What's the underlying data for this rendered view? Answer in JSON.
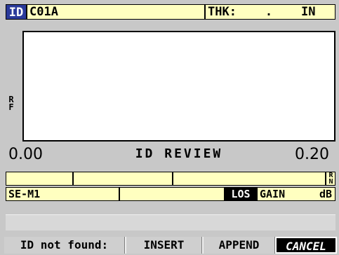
{
  "header": {
    "id_tag": "ID",
    "id_value": "C01A",
    "thk_text": "THK:    .    IN"
  },
  "waveform": {
    "rf_label_line1": "R",
    "rf_label_line2": "F"
  },
  "scale": {
    "left": "0.00",
    "title": "ID REVIEW",
    "right": "0.20"
  },
  "status": {
    "row1": [
      "",
      "",
      ""
    ],
    "rn_line1": "R",
    "rn_line2": "N",
    "mode": "SE-M1",
    "mid": "",
    "los": "LOS",
    "gain_label": "GAIN",
    "gain_unit": "dB"
  },
  "message": "",
  "softkeys": {
    "prompt": "ID not found:",
    "insert": "INSERT",
    "append": "APPEND",
    "cancel": "CANCEL"
  },
  "colors": {
    "background": "#c8c8c8",
    "field": "#ffffc0",
    "id_tag": "#2a3a9a",
    "active_key": "#000000"
  }
}
